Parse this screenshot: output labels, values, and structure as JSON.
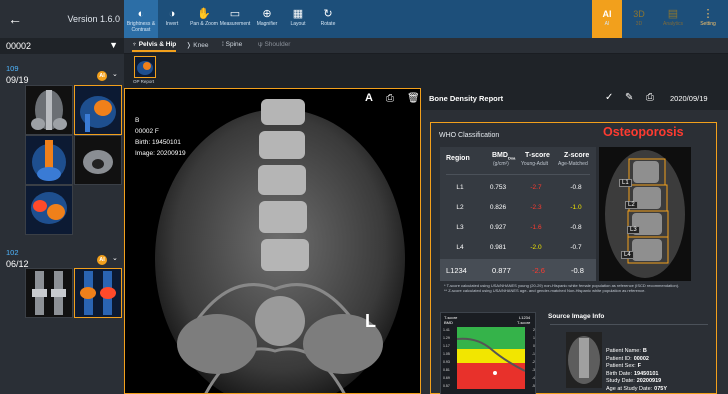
{
  "sidebar": {
    "version": "Version 1.6.0",
    "patient_id": "00002",
    "groups": [
      {
        "number": "109",
        "date": "09/19",
        "ai": "AI"
      },
      {
        "number": "102",
        "date": "06/12",
        "ai": "AI"
      }
    ]
  },
  "toolbar": {
    "tools": [
      {
        "icon": "◐",
        "label": "Brightness & Contrast"
      },
      {
        "icon": "◑",
        "label": "Invert"
      },
      {
        "icon": "✋",
        "label": "Pan & Zoom"
      },
      {
        "icon": "▭",
        "label": "Measurement"
      },
      {
        "icon": "⊕",
        "label": "Magnifier"
      },
      {
        "icon": "▦",
        "label": "Layout"
      },
      {
        "icon": "↻",
        "label": "Rotate"
      }
    ],
    "right": [
      {
        "icon": "AI",
        "label": "AI"
      },
      {
        "icon": "3D",
        "label": "3D"
      },
      {
        "icon": "▤",
        "label": "Analytics"
      },
      {
        "icon": "⋮",
        "label": "Setting"
      }
    ]
  },
  "tabs": [
    "Pelvis & Hip",
    "Knee",
    "Spine",
    "Shoulder"
  ],
  "strip": {
    "label": "OP Report"
  },
  "viewer": {
    "info": [
      "B",
      "00002 F",
      "Birth: 19450101",
      "Image: 20200919"
    ],
    "marker": "L",
    "tool_a": "A"
  },
  "report": {
    "title": "Bone Density Report",
    "date": "2020/09/19",
    "who_label": "WHO Classification",
    "diagnosis": "Osteoporosis",
    "headers": [
      "Region",
      "BMD",
      "T-score",
      "Z-score"
    ],
    "subheaders": [
      "",
      "(g/cm²)",
      "Young-Adult",
      "Age-Matched"
    ],
    "bmd_sub": "Dxa",
    "rows": [
      {
        "region": "L1",
        "bmd": "0.753",
        "t": "-2.7",
        "z": "-0.8",
        "tc": "#ff3b30",
        "zc": "#ffffff"
      },
      {
        "region": "L2",
        "bmd": "0.826",
        "t": "-2.3",
        "z": "-1.0",
        "tc": "#ff3b30",
        "zc": "#f2e600"
      },
      {
        "region": "L3",
        "bmd": "0.927",
        "t": "-1.6",
        "z": "-0.8",
        "tc": "#ff3b30",
        "zc": "#ffffff"
      },
      {
        "region": "L4",
        "bmd": "0.981",
        "t": "-2.0",
        "z": "-0.7",
        "tc": "#f2e600",
        "zc": "#ffffff"
      }
    ],
    "total": {
      "region": "L1234",
      "bmd": "0.877",
      "t": "-2.6",
      "z": "-0.8"
    },
    "spine_labels": [
      "L1",
      "L2",
      "L3",
      "L4"
    ],
    "notes": [
      "* T-score calculated using USA/NHANES young (20-29) non-Hispanic white female population as reference (ISCD recommendation).",
      "** Z-score calculated using USA/NHANES age- and gender-matched Non-Hispanic white population as reference."
    ],
    "graph": {
      "tl": "T-score",
      "tl2": "BMD",
      "tr": "L1234",
      "tr2": "T-score",
      "yl": [
        "1.41",
        "1.29",
        "1.17",
        "1.05",
        "0.93",
        "0.81",
        "0.69",
        "0.57"
      ],
      "yr": [
        "2",
        "1",
        "0",
        "-1",
        "-2",
        "-3",
        "-4",
        "-5"
      ]
    },
    "source": {
      "title": "Source Image Info",
      "lines": [
        {
          "k": "Patient Name:",
          "v": "B"
        },
        {
          "k": "Patient ID:",
          "v": "00002"
        },
        {
          "k": "Patient Sex:",
          "v": "F"
        },
        {
          "k": "Birth Date:",
          "v": "19450101"
        },
        {
          "k": "Study Date:",
          "v": "20200919"
        },
        {
          "k": "Age at Study Date:",
          "v": "075Y"
        }
      ]
    }
  },
  "colors": {
    "accent": "#f2a01c",
    "toolbar": "#1d4f7a",
    "red": "#ff3b30",
    "yellow": "#f2e600",
    "blue": "#4fb6ff"
  }
}
